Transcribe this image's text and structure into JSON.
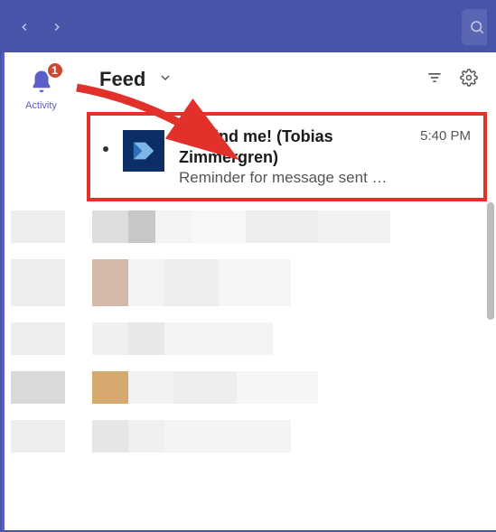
{
  "rail": {
    "activity_label": "Activity",
    "badge_count": "1"
  },
  "feed": {
    "title": "Feed"
  },
  "notification": {
    "title": "Remind me! (Tobias Zimmergren)",
    "subtitle": "Reminder for message sent …",
    "time": "5:40 PM"
  }
}
